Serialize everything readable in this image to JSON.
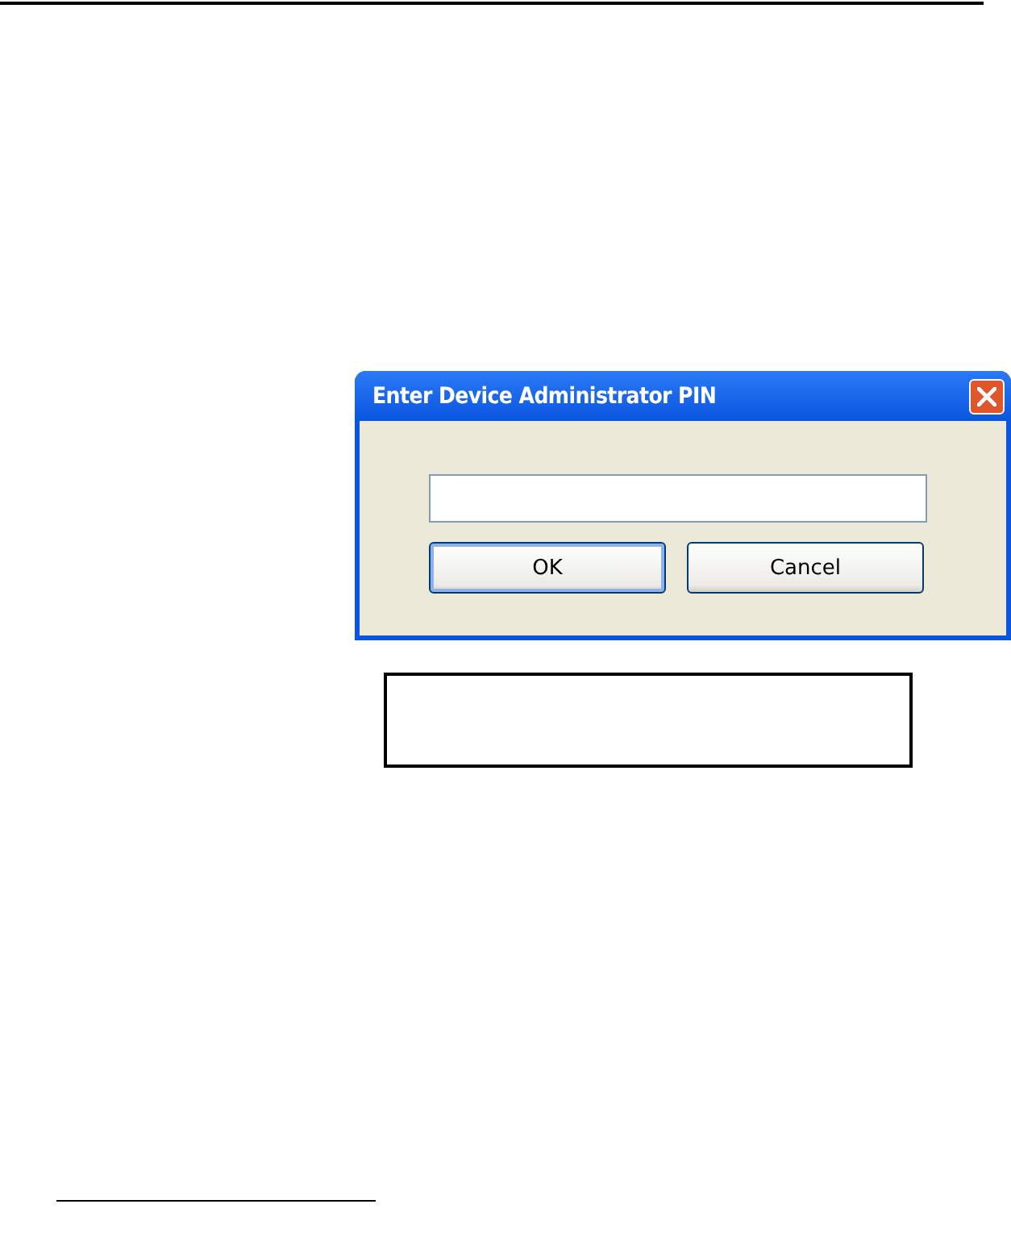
{
  "dialog": {
    "title": "Enter Device Administrator PIN",
    "buttons": [
      {
        "label": "OK",
        "default": true
      },
      {
        "label": "Cancel",
        "default": false
      }
    ]
  }
}
